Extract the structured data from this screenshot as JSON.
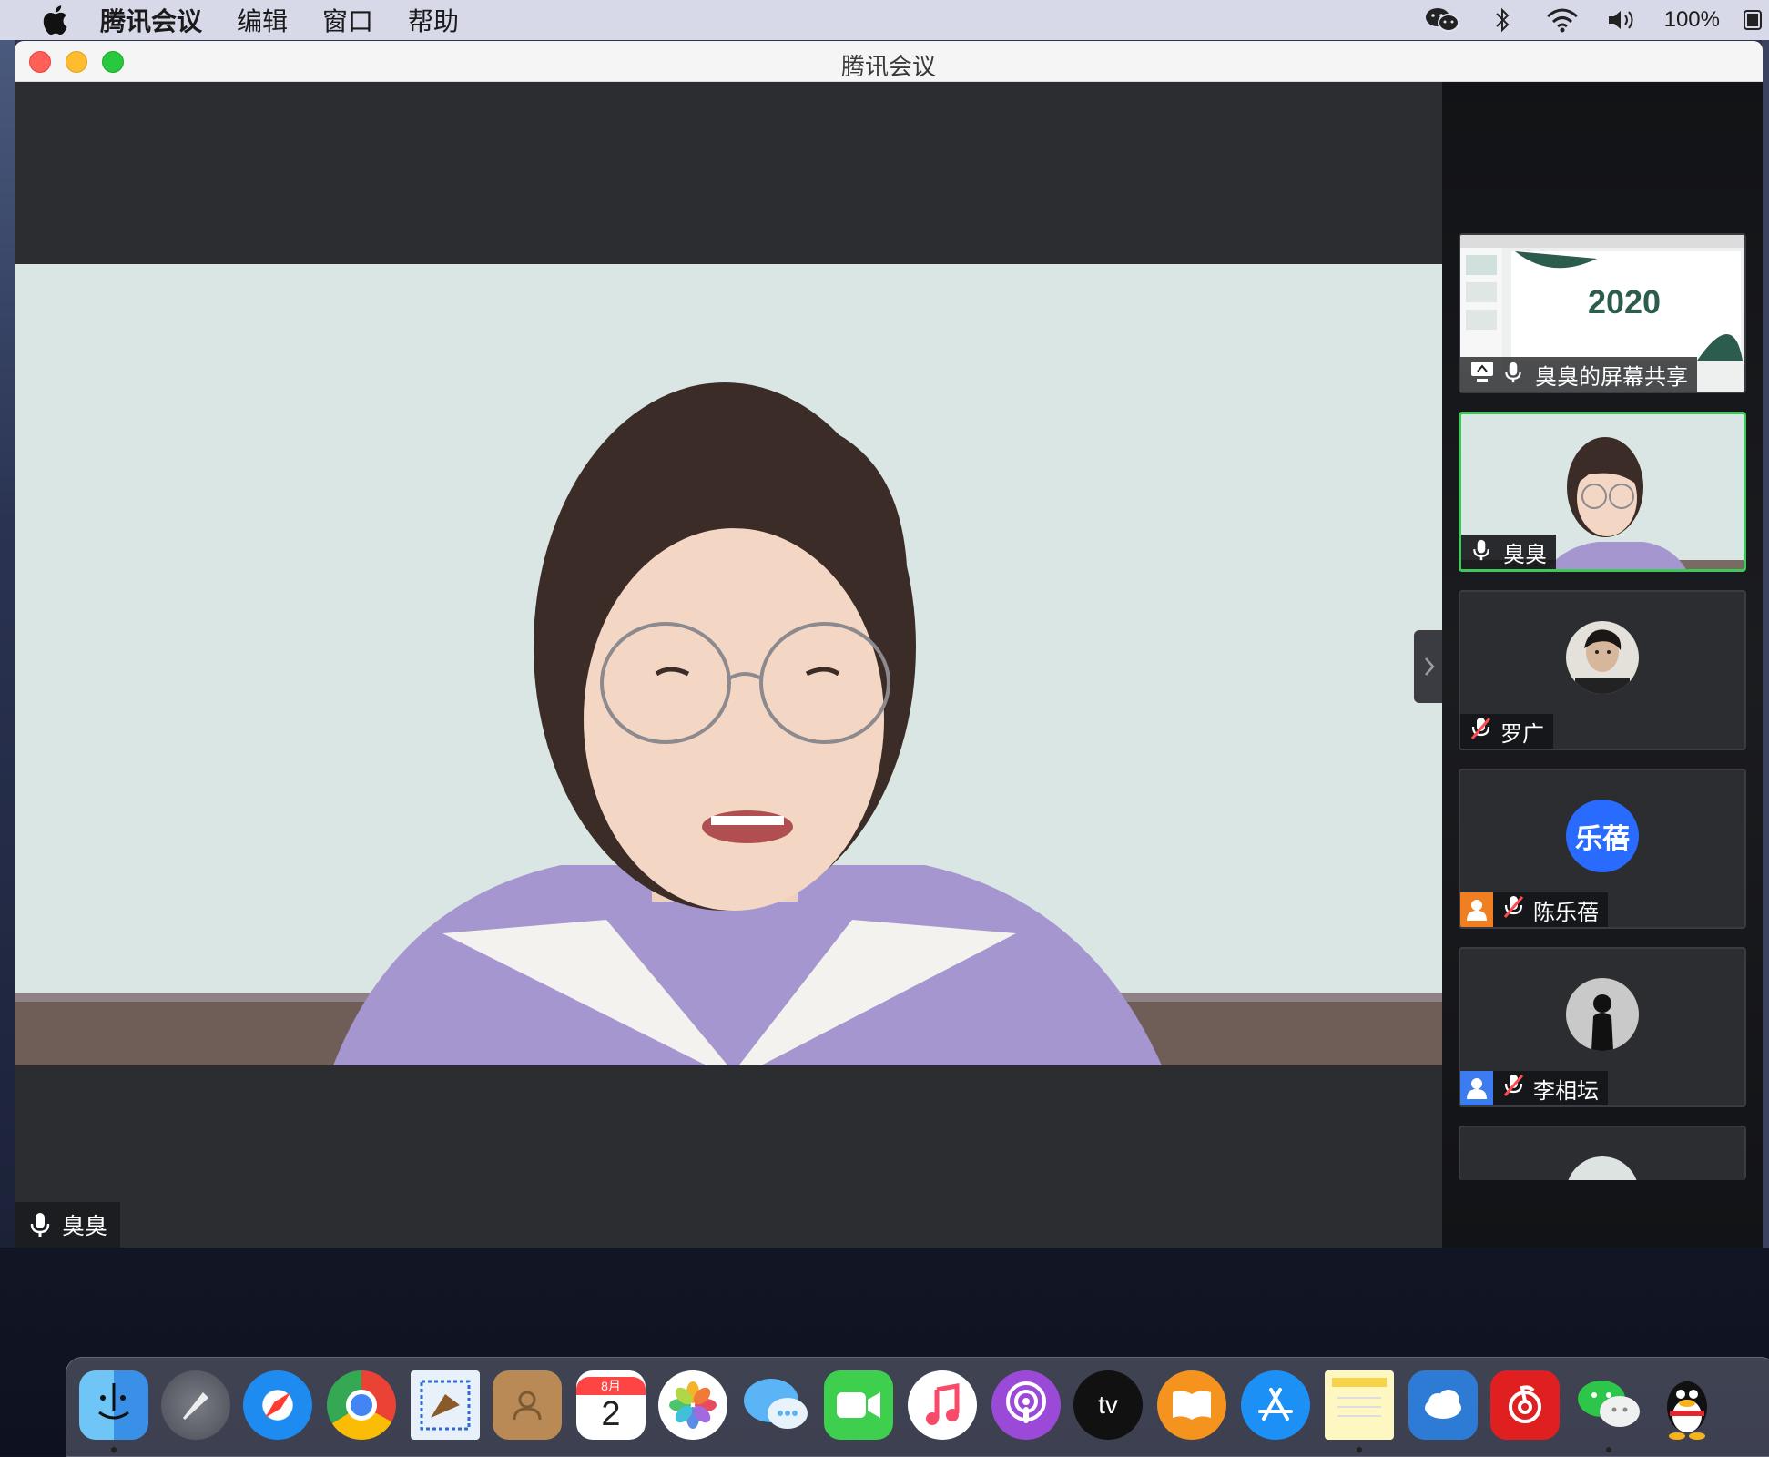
{
  "menubar": {
    "app_name": "腾讯会议",
    "items": [
      "编辑",
      "窗口",
      "帮助"
    ],
    "battery": "100%"
  },
  "window": {
    "title": "腾讯会议"
  },
  "main_video": {
    "speaker_name": "臭臭"
  },
  "participants": [
    {
      "name": "臭臭的屏幕共享",
      "type": "screen_share",
      "slide_text": "2020"
    },
    {
      "name": "臭臭",
      "type": "video",
      "active": true
    },
    {
      "name": "罗广",
      "type": "photo",
      "muted": true
    },
    {
      "name": "陈乐蓓",
      "type": "initials",
      "initials": "乐蓓",
      "muted": true,
      "badge_color": "#f07f22"
    },
    {
      "name": "李相坛",
      "type": "photo",
      "muted": true,
      "badge_color": "#3c7cf0"
    }
  ],
  "dock": {
    "calendar_month": "8月",
    "calendar_day": "2",
    "tv_label": "tv",
    "icons": [
      "finder-icon",
      "launchpad-icon",
      "safari-icon",
      "chrome-icon",
      "mail-icon",
      "contacts-icon",
      "calendar-icon",
      "photos-icon",
      "messages-icon",
      "facetime-icon",
      "music-icon",
      "podcasts-icon",
      "tv-icon",
      "books-icon",
      "appstore-icon",
      "notes-icon",
      "weather-icon",
      "netease-music-icon",
      "wechat-icon",
      "qq-icon"
    ]
  }
}
